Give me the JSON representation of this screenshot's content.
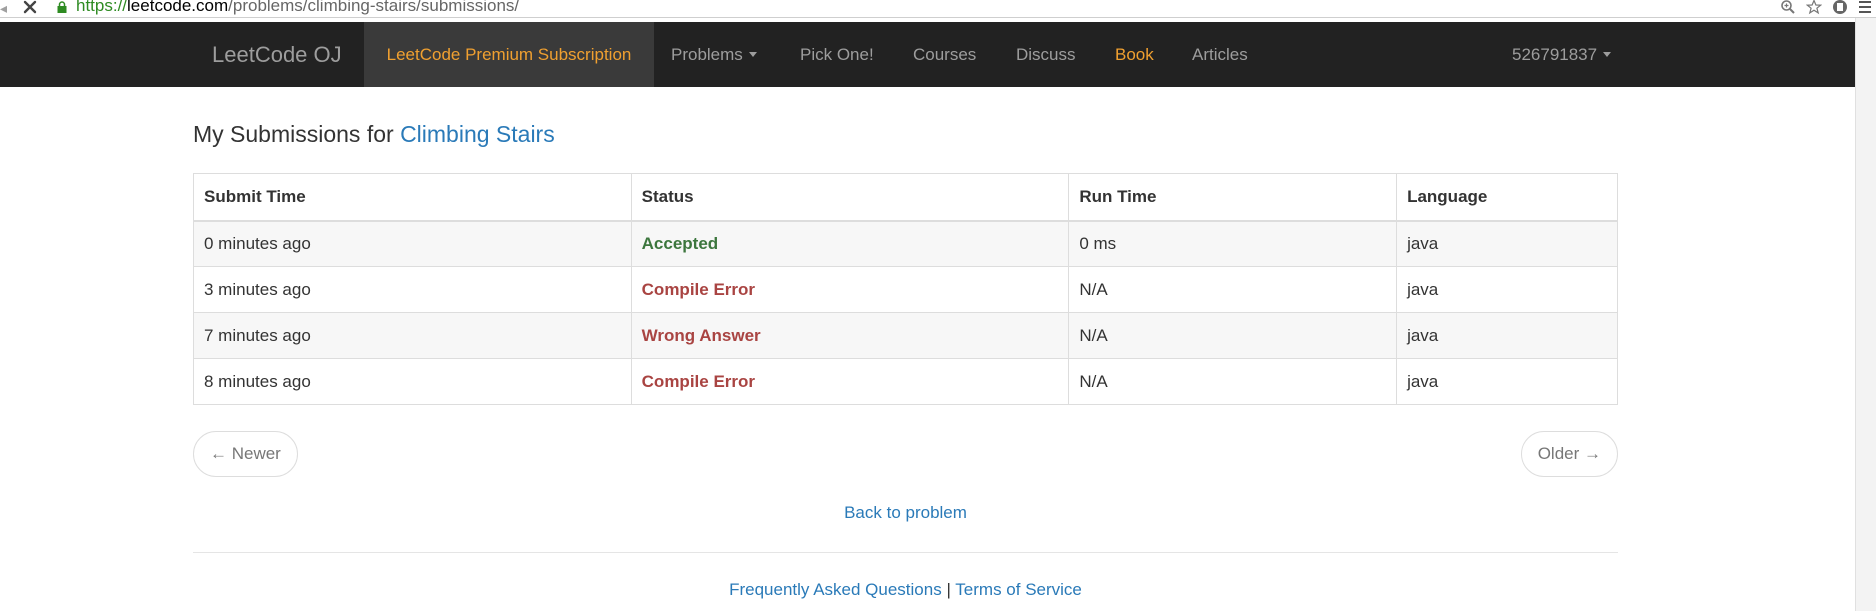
{
  "browser": {
    "url_scheme": "https://",
    "url_host": "leetcode.com",
    "url_path": "/problems/climbing-stairs/submissions/"
  },
  "navbar": {
    "brand": "LeetCode OJ",
    "premium": "LeetCode Premium Subscription",
    "problems": "Problems",
    "pick_one": "Pick One!",
    "courses": "Courses",
    "discuss": "Discuss",
    "book": "Book",
    "articles": "Articles",
    "user": "526791837"
  },
  "page": {
    "title_prefix": "My Submissions for ",
    "problem_name": "Climbing Stairs"
  },
  "table": {
    "headers": {
      "submit_time": "Submit Time",
      "status": "Status",
      "run_time": "Run Time",
      "language": "Language"
    },
    "rows": [
      {
        "submit_time": "0 minutes ago",
        "status": "Accepted",
        "run_time": "0 ms",
        "language": "java"
      },
      {
        "submit_time": "3 minutes ago",
        "status": "Compile Error",
        "run_time": "N/A",
        "language": "java"
      },
      {
        "submit_time": "7 minutes ago",
        "status": "Wrong Answer",
        "run_time": "N/A",
        "language": "java"
      },
      {
        "submit_time": "8 minutes ago",
        "status": "Compile Error",
        "run_time": "N/A",
        "language": "java"
      }
    ]
  },
  "pager": {
    "newer": "← Newer",
    "older": "Older →"
  },
  "back_link": "Back to problem",
  "footer": {
    "faq": "Frequently Asked Questions",
    "separator": "|",
    "terms": "Terms of Service"
  },
  "colors": {
    "accepted": "#3c763d",
    "error": "#a94442",
    "link": "#2a7ab8",
    "navbar_bg": "#222222",
    "accent_orange": "#f0a030"
  },
  "icons": [
    "left-arrow-icon",
    "stop-icon",
    "lock-icon",
    "zoom-icon",
    "star-icon",
    "extension-icon",
    "menu-icon",
    "caret-down-icon"
  ]
}
